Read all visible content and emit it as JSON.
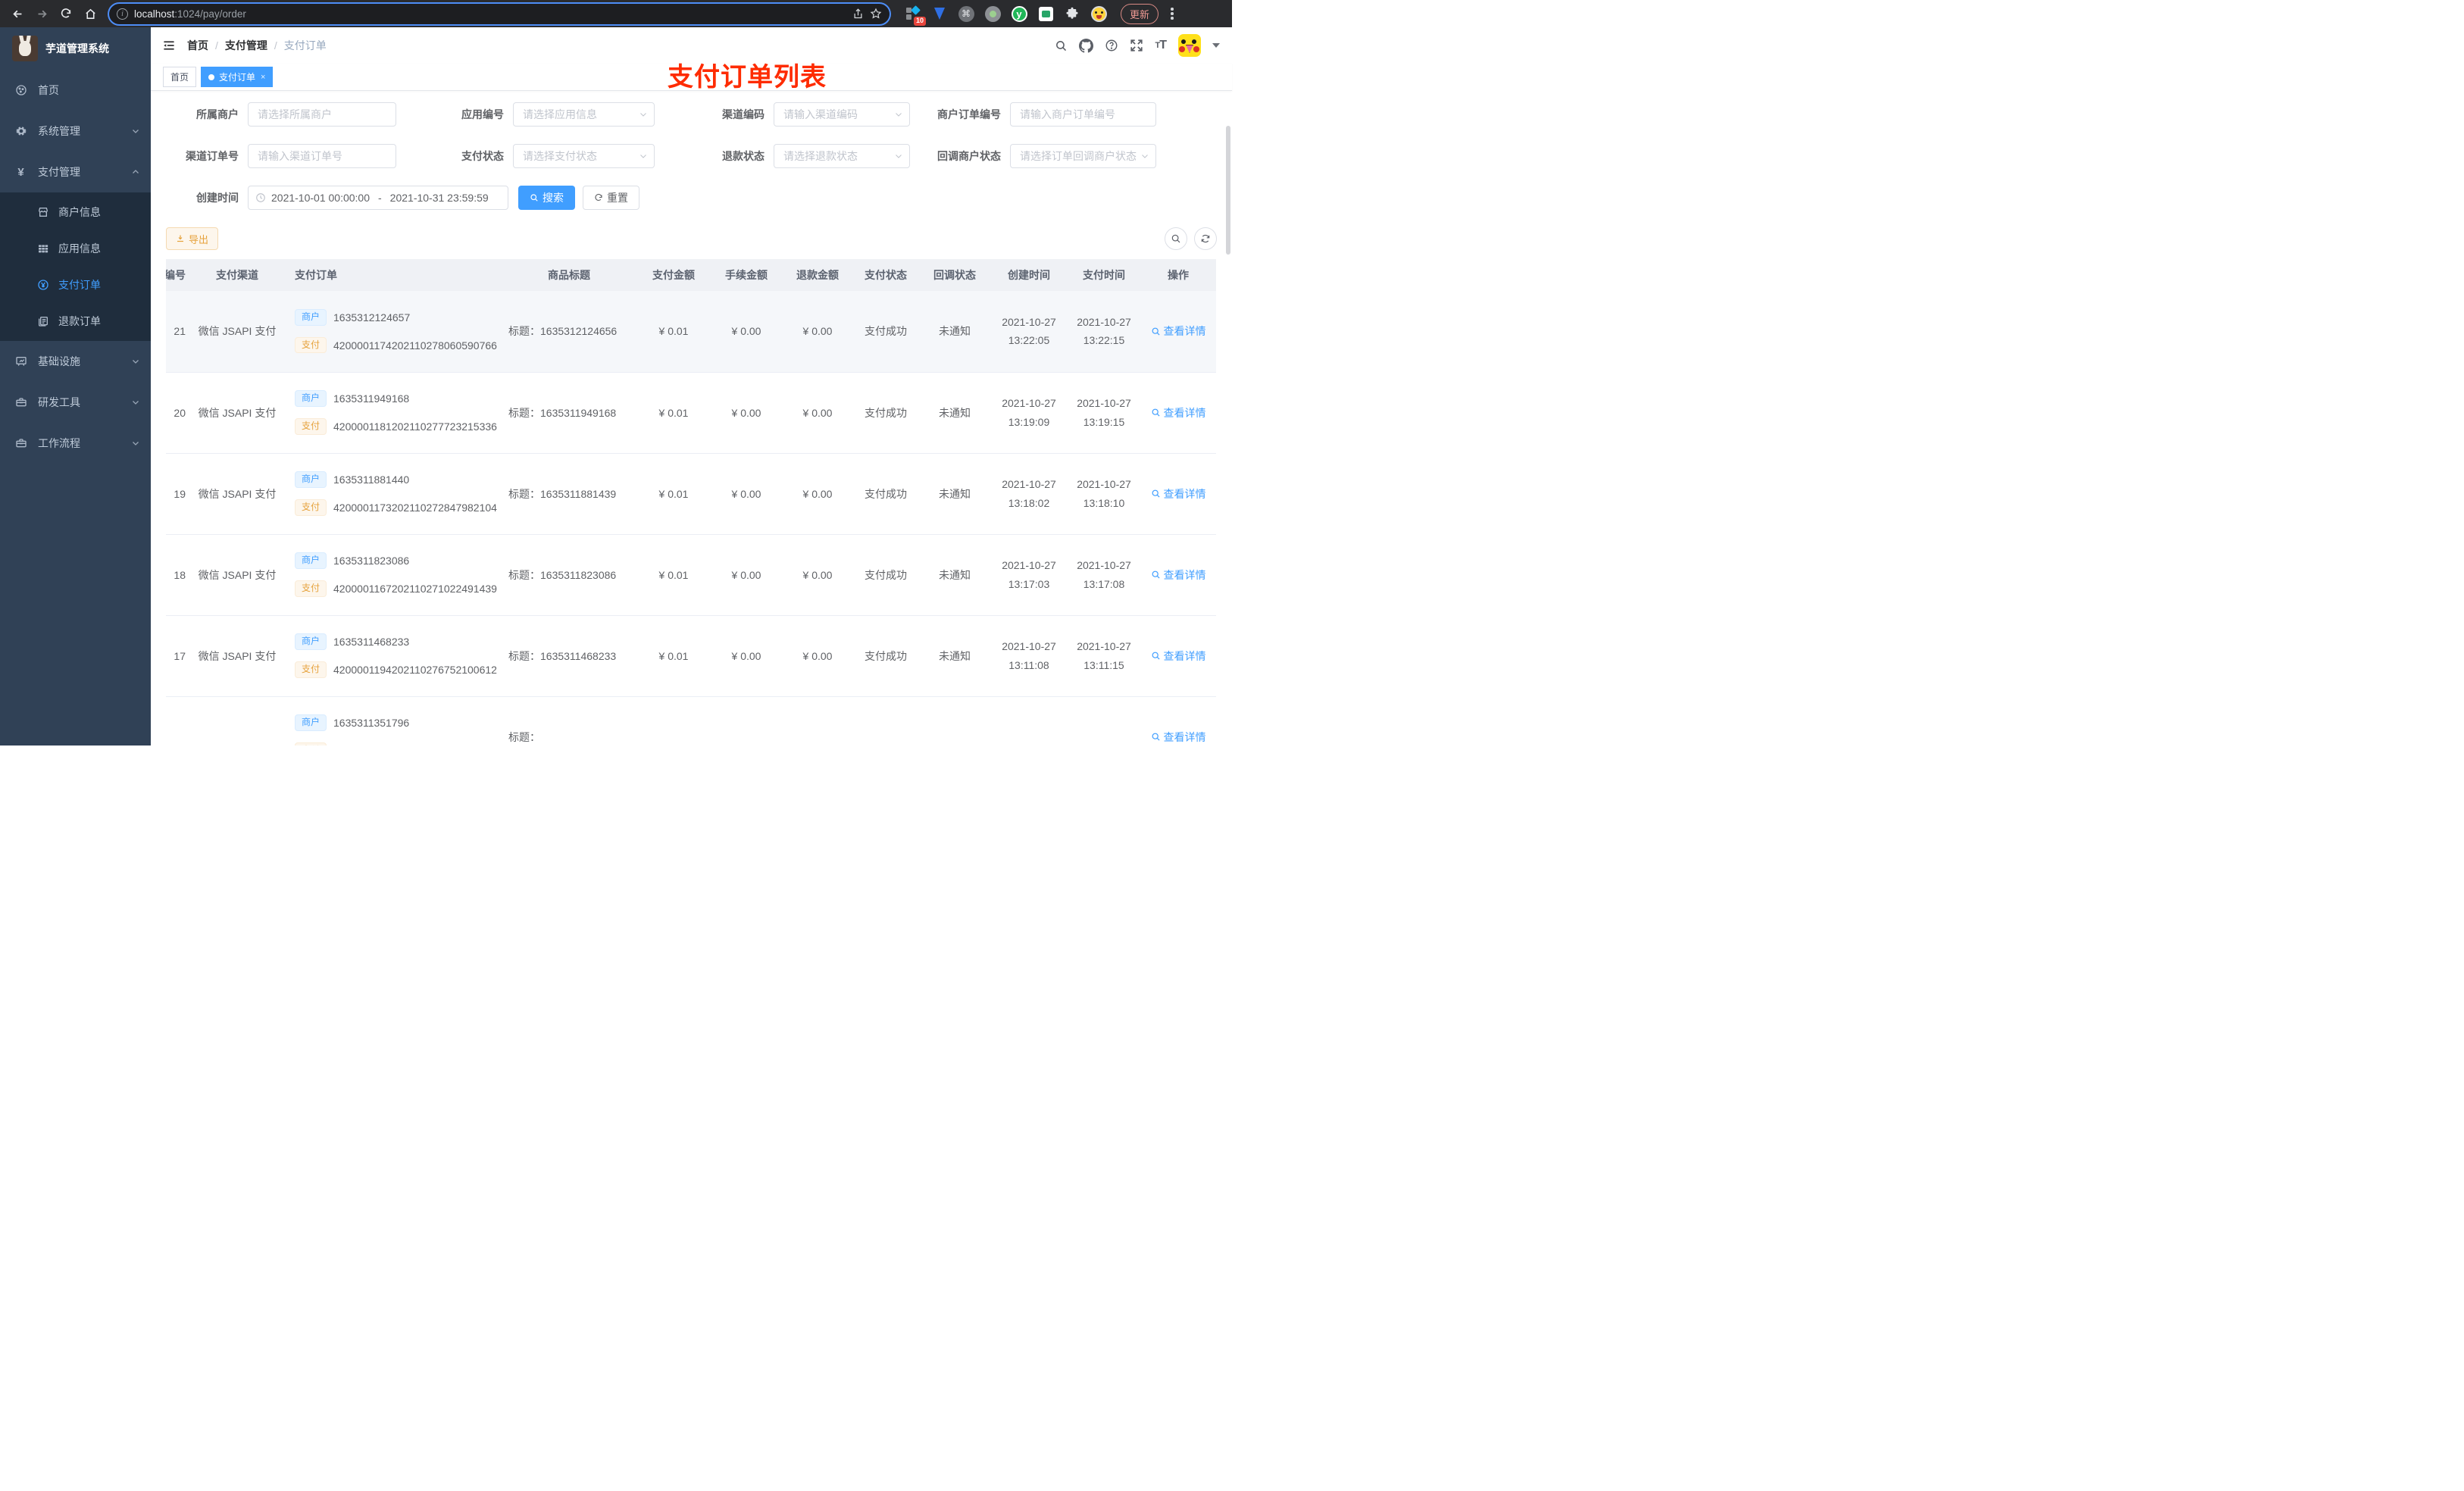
{
  "browser": {
    "url_host": "localhost",
    "url_path": ":1024/pay/order",
    "extension_badge": "10",
    "update_label": "更新"
  },
  "sidebar": {
    "app_title": "芋道管理系统",
    "menu": [
      {
        "label": "首页"
      },
      {
        "label": "系统管理"
      },
      {
        "label": "支付管理"
      },
      {
        "label": "基础设施"
      },
      {
        "label": "研发工具"
      },
      {
        "label": "工作流程"
      }
    ],
    "payment_submenu": [
      {
        "label": "商户信息"
      },
      {
        "label": "应用信息"
      },
      {
        "label": "支付订单"
      },
      {
        "label": "退款订单"
      }
    ]
  },
  "navbar": {
    "breadcrumb": [
      "首页",
      "支付管理",
      "支付订单"
    ],
    "annotation": "支付订单列表"
  },
  "tags": {
    "home": "首页",
    "active": "支付订单",
    "close": "×"
  },
  "search_form": {
    "fields": [
      {
        "label": "所属商户",
        "placeholder": "请选择所属商户"
      },
      {
        "label": "应用编号",
        "placeholder": "请选择应用信息"
      },
      {
        "label": "渠道编码",
        "placeholder": "请输入渠道编码"
      },
      {
        "label": "商户订单编号",
        "placeholder": "请输入商户订单编号"
      },
      {
        "label": "渠道订单号",
        "placeholder": "请输入渠道订单号"
      },
      {
        "label": "支付状态",
        "placeholder": "请选择支付状态"
      },
      {
        "label": "退款状态",
        "placeholder": "请选择退款状态"
      },
      {
        "label": "回调商户状态",
        "placeholder": "请选择订单回调商户状态"
      }
    ],
    "create_time_label": "创建时间",
    "date_start": "2021-10-01 00:00:00",
    "date_separator": "-",
    "date_end": "2021-10-31 23:59:59",
    "search_label": "搜索",
    "reset_label": "重置"
  },
  "toolbar": {
    "export_label": "导出"
  },
  "table": {
    "columns": [
      "编号",
      "支付渠道",
      "支付订单",
      "商品标题",
      "支付金额",
      "手续金额",
      "退款金额",
      "支付状态",
      "回调状态",
      "创建时间",
      "支付时间",
      "操作"
    ],
    "merchant_tag": "商户",
    "pay_tag": "支付",
    "title_prefix": "标题：",
    "action_label": "查看详情",
    "rows": [
      {
        "id": "21",
        "channel": "微信 JSAPI 支付",
        "merchant_no": "1635312124657",
        "pay_no": "4200001174202110278060590766",
        "title": "1635312124656",
        "amount": "¥ 0.01",
        "fee": "¥ 0.00",
        "refund": "¥ 0.00",
        "status": "支付成功",
        "notify": "未通知",
        "create_date": "2021-10-27",
        "create_time": "13:22:05",
        "pay_date": "2021-10-27",
        "pay_time": "13:22:15"
      },
      {
        "id": "20",
        "channel": "微信 JSAPI 支付",
        "merchant_no": "1635311949168",
        "pay_no": "4200001181202110277723215336",
        "title": "1635311949168",
        "amount": "¥ 0.01",
        "fee": "¥ 0.00",
        "refund": "¥ 0.00",
        "status": "支付成功",
        "notify": "未通知",
        "create_date": "2021-10-27",
        "create_time": "13:19:09",
        "pay_date": "2021-10-27",
        "pay_time": "13:19:15"
      },
      {
        "id": "19",
        "channel": "微信 JSAPI 支付",
        "merchant_no": "1635311881440",
        "pay_no": "4200001173202110272847982104",
        "title": "1635311881439",
        "amount": "¥ 0.01",
        "fee": "¥ 0.00",
        "refund": "¥ 0.00",
        "status": "支付成功",
        "notify": "未通知",
        "create_date": "2021-10-27",
        "create_time": "13:18:02",
        "pay_date": "2021-10-27",
        "pay_time": "13:18:10"
      },
      {
        "id": "18",
        "channel": "微信 JSAPI 支付",
        "merchant_no": "1635311823086",
        "pay_no": "4200001167202110271022491439",
        "title": "1635311823086",
        "amount": "¥ 0.01",
        "fee": "¥ 0.00",
        "refund": "¥ 0.00",
        "status": "支付成功",
        "notify": "未通知",
        "create_date": "2021-10-27",
        "create_time": "13:17:03",
        "pay_date": "2021-10-27",
        "pay_time": "13:17:08"
      },
      {
        "id": "17",
        "channel": "微信 JSAPI 支付",
        "merchant_no": "1635311468233",
        "pay_no": "4200001194202110276752100612",
        "title": "1635311468233",
        "amount": "¥ 0.01",
        "fee": "¥ 0.00",
        "refund": "¥ 0.00",
        "status": "支付成功",
        "notify": "未通知",
        "create_date": "2021-10-27",
        "create_time": "13:11:08",
        "pay_date": "2021-10-27",
        "pay_time": "13:11:15"
      },
      {
        "id": "",
        "channel": "",
        "merchant_no": "1635311351796",
        "pay_no": "",
        "title": "",
        "amount": "",
        "fee": "",
        "refund": "",
        "status": "",
        "notify": "",
        "create_date": "",
        "create_time": "",
        "pay_date": "",
        "pay_time": ""
      }
    ]
  },
  "colors": {
    "accent": "#409eff",
    "warning": "#e6a23c",
    "annotation_red": "#fe2b00",
    "sidebar_bg": "#304156",
    "submenu_bg": "#1f2d3d"
  }
}
